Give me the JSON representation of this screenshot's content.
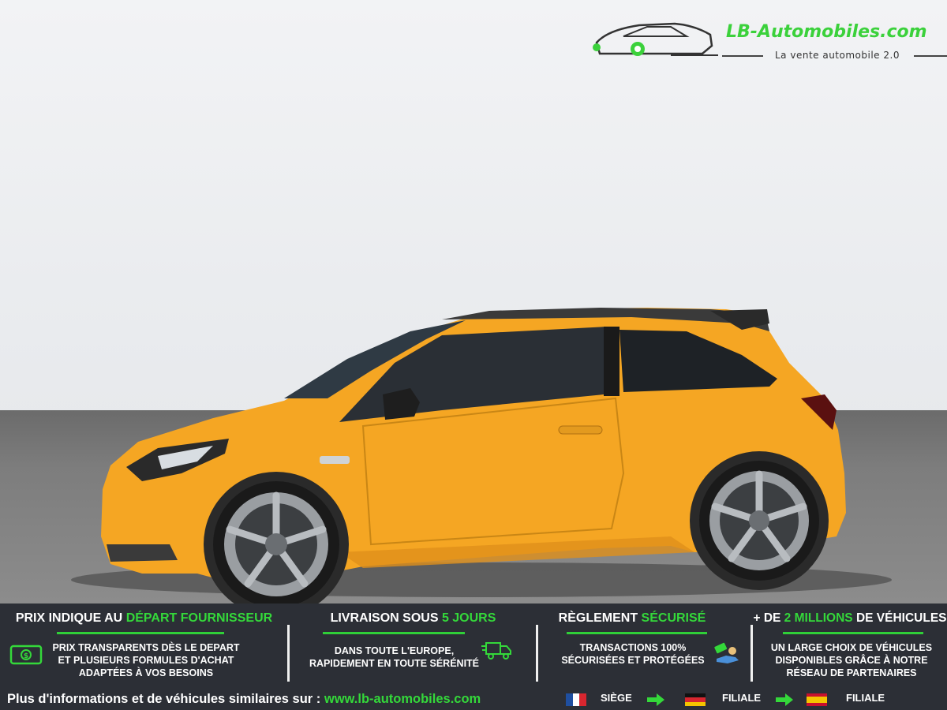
{
  "logo": {
    "name": "LB-Automobiles.com",
    "tagline": "La vente automobile 2.0"
  },
  "colors": {
    "accent_green": "#34d83a",
    "footer_bg": "#2c2f36",
    "car_body": "#f5a623"
  },
  "features": [
    {
      "title_pre": "PRIX INDIQUE AU ",
      "title_hl": "DÉPART FOURNISSEUR",
      "title_post": "",
      "lines": [
        "PRIX TRANSPARENTS DÈS LE DEPART",
        "ET PLUSIEURS FORMULES D'ACHAT",
        "ADAPTÉES À VOS BESOINS"
      ],
      "icon": "money-icon"
    },
    {
      "title_pre": "LIVRAISON SOUS ",
      "title_hl": "5 JOURS",
      "title_post": "",
      "lines": [
        "DANS TOUTE L'EUROPE,",
        "RAPIDEMENT EN TOUTE SÉRÉNITÉ"
      ],
      "icon": "delivery-truck-icon"
    },
    {
      "title_pre": "RÈGLEMENT ",
      "title_hl": "SÉCURISÉ",
      "title_post": "",
      "lines": [
        "TRANSACTIONS 100%",
        "SÉCURISÉES ET PROTÉGÉES"
      ],
      "icon": "payment-hand-icon"
    },
    {
      "title_pre": "+ DE ",
      "title_hl": "2 MILLIONS",
      "title_post": " DE VÉHICULES",
      "lines": [
        "UN LARGE CHOIX DE VÉHICULES",
        "DISPONIBLES GRÂCE À NOTRE",
        "RÉSEAU DE PARTENAIRES"
      ],
      "icon": ""
    }
  ],
  "bottom": {
    "info_text": "Plus d'informations et de véhicules similaires sur : ",
    "url": "www.lb-automobiles.com",
    "locations": [
      {
        "flag": "france-flag-icon",
        "label": "SIÈGE"
      },
      {
        "flag": "germany-flag-icon",
        "label": "FILIALE"
      },
      {
        "flag": "spain-flag-icon",
        "label": "FILIALE"
      }
    ]
  }
}
